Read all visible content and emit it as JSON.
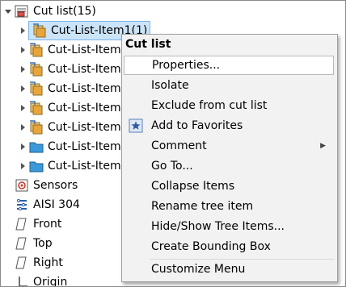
{
  "tree": {
    "root_label": "Cut list(15)",
    "items": [
      {
        "label": "Cut-List-Item1(1)",
        "kind": "bent"
      },
      {
        "label": "Cut-List-Item",
        "kind": "bent"
      },
      {
        "label": "Cut-List-Item",
        "kind": "bent"
      },
      {
        "label": "Cut-List-Item",
        "kind": "bent"
      },
      {
        "label": "Cut-List-Item",
        "kind": "bent"
      },
      {
        "label": "Cut-List-Item",
        "kind": "bent"
      },
      {
        "label": "Cut-List-Item",
        "kind": "folder"
      },
      {
        "label": "Cut-List-Item",
        "kind": "folder"
      }
    ],
    "features": [
      {
        "label": "Sensors",
        "icon": "sensors-icon"
      },
      {
        "label": "AISI 304",
        "icon": "material-icon"
      },
      {
        "label": "Front",
        "icon": "plane-icon"
      },
      {
        "label": "Top",
        "icon": "plane-icon"
      },
      {
        "label": "Right",
        "icon": "plane-icon"
      },
      {
        "label": "Origin",
        "icon": "origin-icon"
      }
    ]
  },
  "context_menu": {
    "title": "Cut list",
    "items": [
      {
        "label": "Properties..."
      },
      {
        "label": "Isolate"
      },
      {
        "label": "Exclude from cut list"
      },
      {
        "label": "Add to Favorites"
      },
      {
        "label": "Comment"
      },
      {
        "label": "Go To..."
      },
      {
        "label": "Collapse Items"
      },
      {
        "label": "Rename tree item"
      },
      {
        "label": "Hide/Show Tree Items..."
      },
      {
        "label": "Create Bounding Box"
      },
      {
        "label": "Customize Menu"
      }
    ]
  },
  "colors": {
    "selection": "#cce4f7",
    "selection_border": "#7eb4ea",
    "menu_bg": "#f2f2f2",
    "folder_blue": "#3a9ad9"
  }
}
